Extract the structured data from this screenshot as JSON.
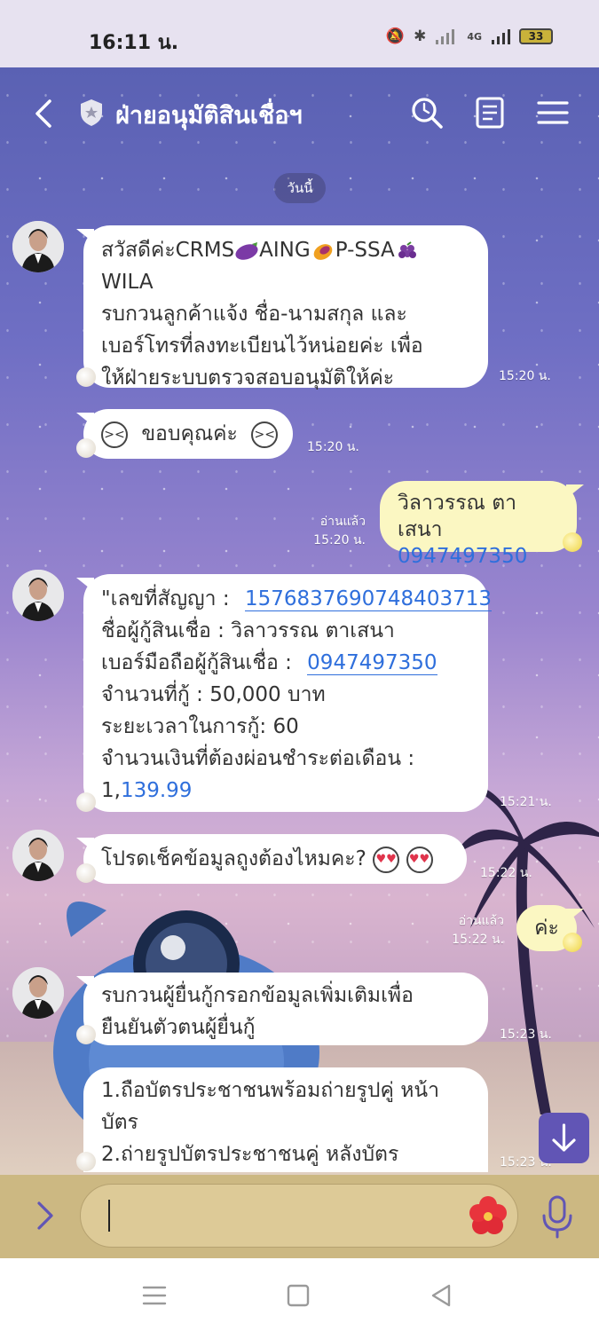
{
  "status": {
    "time": "16:11 น.",
    "battery": "33",
    "network": "4G"
  },
  "header": {
    "title": "ฝ่ายอนุมัติสินเชื่อฯ"
  },
  "date_chip": "วันนี้",
  "messages": {
    "m1": {
      "greeting": "สวัสดีค่ะCRMS",
      "t2": "AING",
      "t3": "P-SSA",
      "line2": "WILA",
      "line3": "รบกวนลูกค้าแจ้ง ชื่อ-นามสกุล และ",
      "line4": "เบอร์โทรที่ลงทะเบียนไว้หน่อยค่ะ เพื่อ",
      "line5": "ให้ฝ่ายระบบตรวจสอบอนุมัติให้ค่ะ",
      "time": "15:20 น."
    },
    "m2": {
      "text": "ขอบคุณค่ะ",
      "time": "15:20 น."
    },
    "m3": {
      "read": "อ่านแล้ว",
      "time": "15:20 น.",
      "name": "วิลาวรรณ ตาเสนา",
      "phone": "0947497350"
    },
    "m4": {
      "l1_label": "\"เลขที่สัญญา :",
      "l1_value": "1576837690748403713",
      "l2": "ชื่อผู้กู้สินเชื่อ :  วิลาวรรณ ตาเสนา",
      "l3_label": "เบอร์มือถือผู้กู้สินเชื่อ :",
      "l3_value": "0947497350",
      "l4": "จำนวนที่กู้ :  50,000 บาท",
      "l5": "ระยะเวลาในการกู้:   60",
      "l6": "จำนวนเงินที่ต้องผ่อนชำระต่อเดือน :",
      "l7_a": "1,",
      "l7_b": "139.99",
      "time": "15:21 น."
    },
    "m5": {
      "text": "โปรดเช็คข้อมูลถูงต้องไหมคะ?",
      "time": "15:22 น."
    },
    "m6": {
      "read": "อ่านแล้ว",
      "time": "15:22 น.",
      "text": "ค่ะ"
    },
    "m7": {
      "line1": "รบกวนผู้ยื่นกู้กรอกข้อมูลเพิ่มเติมเพื่อ",
      "line2": "ยืนยันตัวตนผู้ยื่นกู้",
      "time": "15:23 น."
    },
    "m8": {
      "line1": "1.ถือบัตรประชาชนพร้อมถ่ายรูปคู่ หน้า",
      "line2": "บัตร",
      "line3": "2.ถ่ายรูปบัตรประชาชนคู่ หลังบัตร",
      "time": "15:23 น."
    }
  },
  "colors": {
    "accent": "#6155b5",
    "link": "#2f6fdc",
    "my_bubble": "#fbf7c2",
    "input_bar": "#ccb882"
  },
  "icons": [
    "back-icon",
    "shield-icon",
    "search-icon",
    "notes-icon",
    "menu-icon",
    "arrow-down-icon",
    "chevron-right-icon",
    "hibiscus-icon",
    "mic-icon"
  ]
}
